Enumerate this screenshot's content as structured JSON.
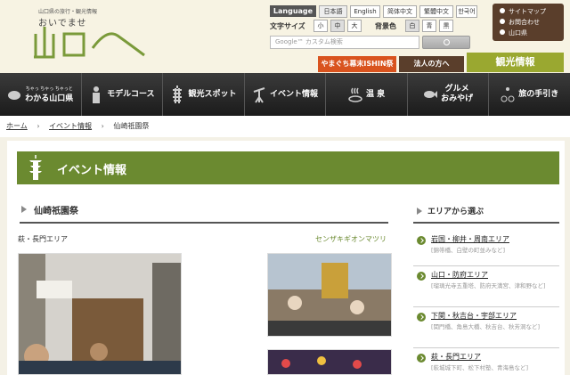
{
  "header": {
    "tagline": "山口県の旅行・観光情報",
    "site_name": "おいでませ",
    "logo_text": "山口へ",
    "language_label": "Language",
    "languages": [
      "日本語",
      "English",
      "简体中文",
      "繁體中文",
      "한국어"
    ],
    "font_size_label": "文字サイズ",
    "font_sizes": [
      "小",
      "中",
      "大"
    ],
    "bg_color_label": "背景色",
    "bg_colors": [
      "白",
      "青",
      "黒"
    ],
    "search_placeholder": "Google™ カスタム検索",
    "util_links": [
      "サイトマップ",
      "お問合わせ",
      "山口県"
    ],
    "banners": [
      {
        "label": "やまぐち幕末ISHIN祭",
        "color": "#d9531e"
      },
      {
        "label": "法人の方へ",
        "color": "#5a3e2b"
      },
      {
        "label": "観光情報",
        "color": "#9aa830"
      }
    ]
  },
  "nav": [
    {
      "sub": "ちゃっ ちゃっ ちゃっと",
      "label": "わかる山口県",
      "icon": "fugu-icon"
    },
    {
      "label": "モデルコース",
      "icon": "samurai-icon"
    },
    {
      "label": "観光スポット",
      "icon": "pagoda-icon"
    },
    {
      "label": "イベント情報",
      "icon": "dancer-icon"
    },
    {
      "label": "温 泉",
      "icon": "hot-spring-icon"
    },
    {
      "label": "グルメ",
      "label2": "おみやげ",
      "icon": "fish-icon"
    },
    {
      "label": "旅の手引き",
      "icon": "bicycle-icon"
    }
  ],
  "breadcrumb": {
    "home": "ホーム",
    "events": "イベント情報",
    "current": "仙崎祇園祭"
  },
  "main": {
    "section_title": "イベント情報",
    "page_title": "仙崎祇園祭",
    "area": "萩・長門エリア",
    "reading": "センザキギオンマツリ"
  },
  "sidebar": {
    "title": "エリアから選ぶ",
    "items": [
      {
        "name": "岩国・柳井・周南エリア",
        "desc": "[錦帯橋、白壁の町並みなど]"
      },
      {
        "name": "山口・防府エリア",
        "desc": "[瑠璃光寺五重塔、防府天満宮、津和野など]"
      },
      {
        "name": "下関・秋吉台・宇部エリア",
        "desc": "[関門橋、角島大橋、秋吉台、秋芳洞など]"
      },
      {
        "name": "萩・長門エリア",
        "desc": "[萩城城下町、松下村塾、青海島など]"
      }
    ]
  }
}
